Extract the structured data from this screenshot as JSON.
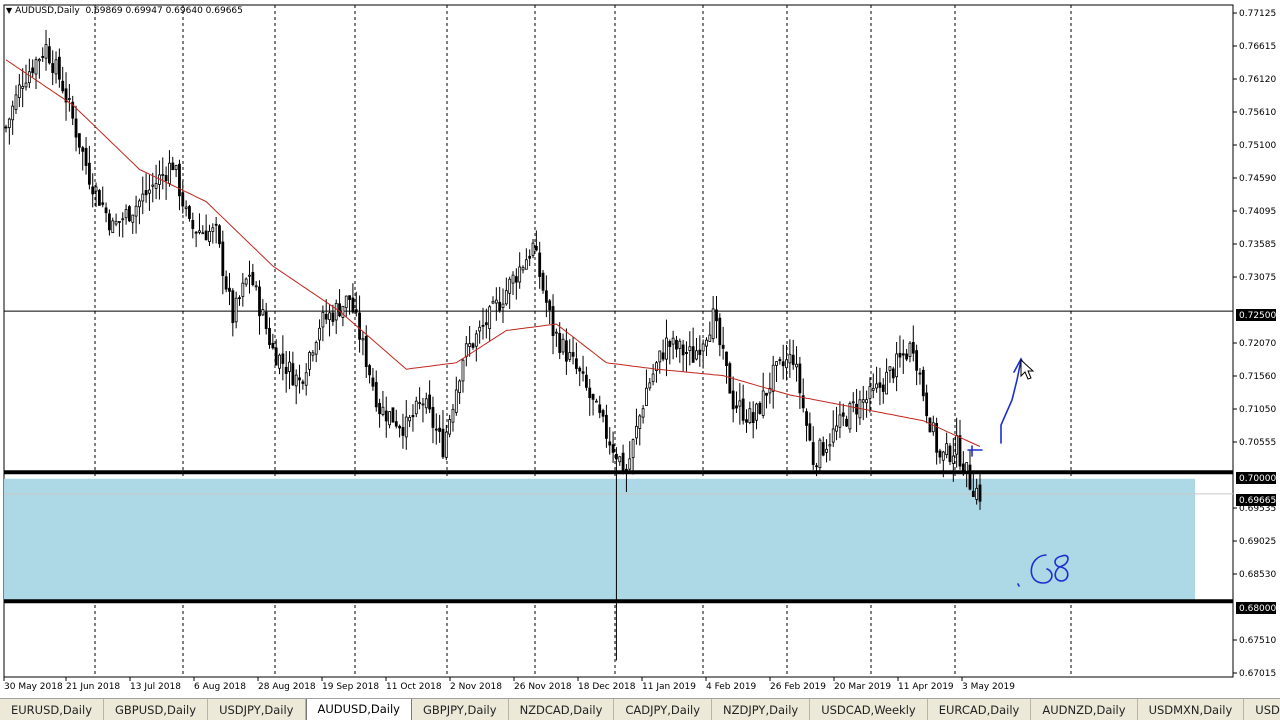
{
  "header": {
    "symbol": "AUDUSD,Daily",
    "ohlc": "0.69869 0.69947 0.69640 0.69665"
  },
  "price_axis": {
    "ticks": [
      "0.77125",
      "0.76615",
      "0.76120",
      "0.75610",
      "0.75100",
      "0.74590",
      "0.74095",
      "0.73585",
      "0.73075",
      "0.72070",
      "0.71560",
      "0.71050",
      "0.70555",
      "0.69535",
      "0.69025",
      "0.68530",
      "0.67510",
      "0.67015"
    ],
    "level_labels": [
      "0.72500",
      "0.70000",
      "0.69665",
      "0.68000"
    ]
  },
  "date_axis": [
    "30 May 2018",
    "21 Jun 2018",
    "13 Jul 2018",
    "6 Aug 2018",
    "28 Aug 2018",
    "19 Sep 2018",
    "11 Oct 2018",
    "2 Nov 2018",
    "26 Nov 2018",
    "18 Dec 2018",
    "11 Jan 2019",
    "4 Feb 2019",
    "26 Feb 2019",
    "20 Mar 2019",
    "11 Apr 2019",
    "3 May 2019"
  ],
  "chart_data": {
    "type": "candlestick",
    "symbol": "AUDUSD",
    "timeframe": "Daily",
    "ylim": [
      0.669,
      0.7725
    ],
    "price_levels": [
      0.725,
      0.7,
      0.68
    ],
    "support_zone": [
      0.68,
      0.699
    ],
    "current_price": 0.69665,
    "moving_average_color": "#c0261e",
    "close_anchors": [
      [
        0,
        0.7535
      ],
      [
        5,
        0.761
      ],
      [
        12,
        0.766
      ],
      [
        17,
        0.76
      ],
      [
        25,
        0.746
      ],
      [
        32,
        0.738
      ],
      [
        40,
        0.742
      ],
      [
        50,
        0.748
      ],
      [
        55,
        0.738
      ],
      [
        63,
        0.737
      ],
      [
        68,
        0.724
      ],
      [
        73,
        0.731
      ],
      [
        80,
        0.719
      ],
      [
        88,
        0.714
      ],
      [
        94,
        0.723
      ],
      [
        103,
        0.727
      ],
      [
        112,
        0.71
      ],
      [
        120,
        0.707
      ],
      [
        125,
        0.711
      ],
      [
        131,
        0.704
      ],
      [
        137,
        0.718
      ],
      [
        145,
        0.724
      ],
      [
        152,
        0.73
      ],
      [
        158,
        0.735
      ],
      [
        164,
        0.722
      ],
      [
        172,
        0.715
      ],
      [
        180,
        0.706
      ],
      [
        186,
        0.7
      ],
      [
        192,
        0.713
      ],
      [
        198,
        0.72
      ],
      [
        206,
        0.718
      ],
      [
        212,
        0.724
      ],
      [
        218,
        0.711
      ],
      [
        224,
        0.708
      ],
      [
        230,
        0.715
      ],
      [
        236,
        0.718
      ],
      [
        242,
        0.702
      ],
      [
        248,
        0.706
      ],
      [
        254,
        0.71
      ],
      [
        260,
        0.712
      ],
      [
        266,
        0.716
      ],
      [
        272,
        0.72
      ],
      [
        276,
        0.71
      ],
      [
        280,
        0.702
      ],
      [
        285,
        0.704
      ],
      [
        289,
        0.6985
      ],
      [
        292,
        0.6966
      ]
    ],
    "ma_anchors": [
      [
        0,
        0.764
      ],
      [
        20,
        0.757
      ],
      [
        40,
        0.747
      ],
      [
        60,
        0.742
      ],
      [
        80,
        0.732
      ],
      [
        100,
        0.725
      ],
      [
        120,
        0.716
      ],
      [
        135,
        0.717
      ],
      [
        150,
        0.722
      ],
      [
        165,
        0.723
      ],
      [
        180,
        0.717
      ],
      [
        195,
        0.716
      ],
      [
        215,
        0.715
      ],
      [
        235,
        0.712
      ],
      [
        255,
        0.71
      ],
      [
        275,
        0.708
      ],
      [
        292,
        0.704
      ]
    ],
    "spike_low": 0.6708,
    "drawings": [
      "upward arrow",
      "68"
    ]
  },
  "tabs": [
    {
      "label": "EURUSD,Daily",
      "active": false
    },
    {
      "label": "GBPUSD,Daily",
      "active": false
    },
    {
      "label": "USDJPY,Daily",
      "active": false
    },
    {
      "label": "AUDUSD,Daily",
      "active": true
    },
    {
      "label": "GBPJPY,Daily",
      "active": false
    },
    {
      "label": "NZDCAD,Daily",
      "active": false
    },
    {
      "label": "CADJPY,Daily",
      "active": false
    },
    {
      "label": "NZDJPY,Daily",
      "active": false
    },
    {
      "label": "USDCAD,Weekly",
      "active": false
    },
    {
      "label": "EURCAD,Daily",
      "active": false
    },
    {
      "label": "AUDNZD,Daily",
      "active": false
    },
    {
      "label": "USDMXN,Daily",
      "active": false
    },
    {
      "label": "USDSEK,Daily",
      "active": false
    }
  ]
}
